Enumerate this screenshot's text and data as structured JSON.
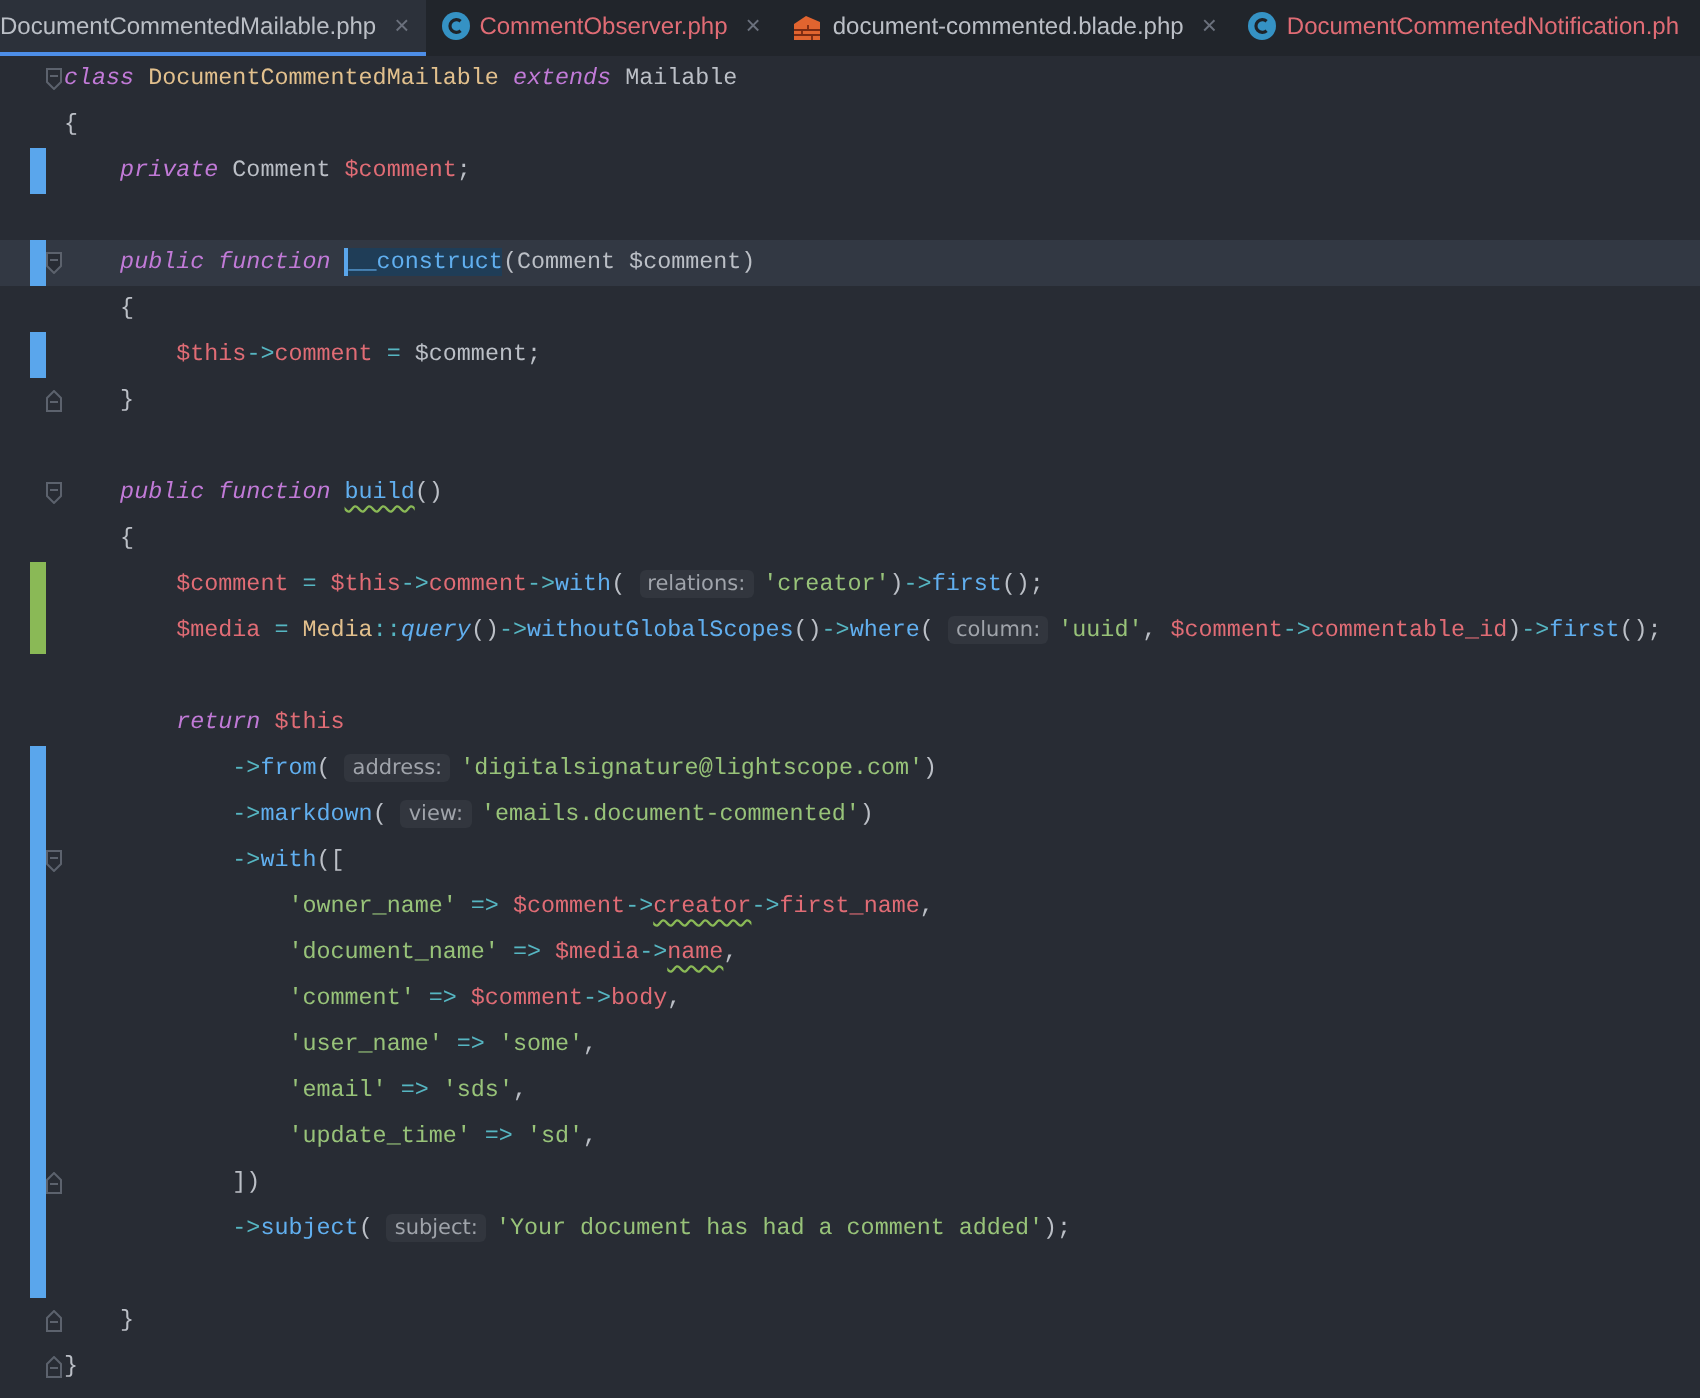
{
  "tabs": [
    {
      "label": "DocumentCommentedMailable.php",
      "kind": "plain",
      "has_errors": false,
      "selected": true,
      "close": "×"
    },
    {
      "label": "CommentObserver.php",
      "kind": "class",
      "has_errors": true,
      "selected": false,
      "close": "×"
    },
    {
      "label": "document-commented.blade.php",
      "kind": "blade",
      "has_errors": false,
      "selected": false,
      "close": "×"
    },
    {
      "label": "DocumentCommentedNotification.ph",
      "kind": "class",
      "has_errors": true,
      "selected": false
    }
  ],
  "lines": [
    {
      "kind": "unchanged",
      "fold_open": true,
      "fold_close": false,
      "current": false,
      "tokens": [
        {
          "kind": "kw",
          "text": "class "
        },
        {
          "kind": "type",
          "text": "DocumentCommentedMailable "
        },
        {
          "kind": "kw",
          "text": "extends"
        },
        {
          "kind": "plain",
          "text": " Mailable"
        }
      ]
    },
    {
      "kind": "unchanged",
      "fold_open": false,
      "fold_close": false,
      "current": false,
      "tokens": [
        {
          "kind": "plain",
          "text": "{"
        }
      ]
    },
    {
      "kind": "modified",
      "fold_open": false,
      "fold_close": false,
      "current": false,
      "tokens": [
        {
          "kind": "kw",
          "text": "    private"
        },
        {
          "kind": "plain",
          "text": " Comment "
        },
        {
          "kind": "var",
          "text": "$comment"
        },
        {
          "kind": "plain",
          "text": ";"
        }
      ]
    },
    {
      "kind": "unchanged",
      "fold_open": false,
      "fold_close": false,
      "current": false
    },
    {
      "kind": "modified",
      "fold_open": true,
      "fold_close": false,
      "current": true,
      "tokens": [
        {
          "kind": "kw",
          "text": "    public function "
        },
        {
          "kind": "fn-selected",
          "text": "__construct"
        },
        {
          "kind": "plain",
          "text": "(Comment $comment)"
        }
      ]
    },
    {
      "kind": "unchanged",
      "fold_open": false,
      "fold_close": false,
      "current": false,
      "tokens": [
        {
          "kind": "plain",
          "text": "    {"
        }
      ]
    },
    {
      "kind": "modified",
      "fold_open": false,
      "fold_close": false,
      "current": false,
      "tokens": [
        {
          "kind": "var",
          "text": "        $this"
        },
        {
          "kind": "op",
          "text": "->"
        },
        {
          "kind": "var",
          "text": "comment"
        },
        {
          "kind": "op",
          "text": " = "
        },
        {
          "kind": "plain",
          "text": "$comment;"
        }
      ]
    },
    {
      "kind": "unchanged",
      "fold_open": false,
      "fold_close": true,
      "current": false,
      "tokens": [
        {
          "kind": "plain",
          "text": "    }"
        }
      ]
    },
    {
      "kind": "unchanged",
      "fold_open": false,
      "fold_close": false,
      "current": false
    },
    {
      "kind": "unchanged",
      "fold_open": true,
      "fold_close": false,
      "current": false,
      "tokens": [
        {
          "kind": "kw",
          "text": "    public function "
        },
        {
          "kind": "fn-typo",
          "text": "build"
        },
        {
          "kind": "plain",
          "text": "()"
        }
      ]
    },
    {
      "kind": "unchanged",
      "fold_open": false,
      "fold_close": false,
      "current": false,
      "tokens": [
        {
          "kind": "plain",
          "text": "    {"
        }
      ]
    },
    {
      "kind": "added",
      "fold_open": false,
      "fold_close": false,
      "current": false,
      "tokens": [
        {
          "kind": "var",
          "text": "        $comment"
        },
        {
          "kind": "op",
          "text": " = "
        },
        {
          "kind": "var",
          "text": "$this"
        },
        {
          "kind": "op",
          "text": "->"
        },
        {
          "kind": "var",
          "text": "comment"
        },
        {
          "kind": "op",
          "text": "->"
        },
        {
          "kind": "fn",
          "text": "with"
        },
        {
          "kind": "plain",
          "text": "( "
        },
        {
          "kind": "hint",
          "text": "relations:"
        },
        {
          "kind": "str",
          "text": "'creator'"
        },
        {
          "kind": "plain",
          "text": ")"
        },
        {
          "kind": "op",
          "text": "->"
        },
        {
          "kind": "fn",
          "text": "first"
        },
        {
          "kind": "plain",
          "text": "();"
        }
      ]
    },
    {
      "kind": "added",
      "fold_open": false,
      "fold_close": false,
      "current": false,
      "tokens": [
        {
          "kind": "var",
          "text": "        $media"
        },
        {
          "kind": "op",
          "text": " = "
        },
        {
          "kind": "type",
          "text": "Media"
        },
        {
          "kind": "op",
          "text": "::"
        },
        {
          "kind": "fn-static",
          "text": "query"
        },
        {
          "kind": "plain",
          "text": "()"
        },
        {
          "kind": "op",
          "text": "->"
        },
        {
          "kind": "fn",
          "text": "withoutGlobalScopes"
        },
        {
          "kind": "plain",
          "text": "()"
        },
        {
          "kind": "op",
          "text": "->"
        },
        {
          "kind": "fn",
          "text": "where"
        },
        {
          "kind": "plain",
          "text": "( "
        },
        {
          "kind": "hint",
          "text": "column:"
        },
        {
          "kind": "str",
          "text": "'uuid'"
        },
        {
          "kind": "plain",
          "text": ", "
        },
        {
          "kind": "var",
          "text": "$comment"
        },
        {
          "kind": "op",
          "text": "->"
        },
        {
          "kind": "var",
          "text": "commentable_id"
        },
        {
          "kind": "plain",
          "text": ")"
        },
        {
          "kind": "op",
          "text": "->"
        },
        {
          "kind": "fn",
          "text": "first"
        },
        {
          "kind": "plain",
          "text": "();"
        }
      ]
    },
    {
      "kind": "unchanged",
      "fold_open": false,
      "fold_close": false,
      "current": false
    },
    {
      "kind": "unchanged",
      "fold_open": false,
      "fold_close": false,
      "current": false,
      "tokens": [
        {
          "kind": "kw",
          "text": "        return "
        },
        {
          "kind": "var",
          "text": "$this"
        }
      ]
    },
    {
      "kind": "modified",
      "fold_open": false,
      "fold_close": false,
      "current": false,
      "tokens": [
        {
          "kind": "op",
          "text": "            ->"
        },
        {
          "kind": "fn",
          "text": "from"
        },
        {
          "kind": "plain",
          "text": "( "
        },
        {
          "kind": "hint",
          "text": "address:"
        },
        {
          "kind": "str",
          "text": "'digitalsignature@lightscope.com'"
        },
        {
          "kind": "plain",
          "text": ")"
        }
      ]
    },
    {
      "kind": "modified",
      "fold_open": false,
      "fold_close": false,
      "current": false,
      "tokens": [
        {
          "kind": "op",
          "text": "            ->"
        },
        {
          "kind": "fn",
          "text": "markdown"
        },
        {
          "kind": "plain",
          "text": "( "
        },
        {
          "kind": "hint",
          "text": "view:"
        },
        {
          "kind": "str",
          "text": "'emails.document-commented'"
        },
        {
          "kind": "plain",
          "text": ")"
        }
      ]
    },
    {
      "kind": "modified",
      "fold_open": true,
      "fold_close": false,
      "current": false,
      "tokens": [
        {
          "kind": "op",
          "text": "            ->"
        },
        {
          "kind": "fn",
          "text": "with"
        },
        {
          "kind": "plain",
          "text": "(["
        }
      ]
    },
    {
      "kind": "modified",
      "fold_open": false,
      "fold_close": false,
      "current": false,
      "tokens": [
        {
          "kind": "str",
          "text": "                'owner_name'"
        },
        {
          "kind": "op",
          "text": " => "
        },
        {
          "kind": "var",
          "text": "$comment"
        },
        {
          "kind": "op",
          "text": "->"
        },
        {
          "kind": "var-typo",
          "text": "creator"
        },
        {
          "kind": "op",
          "text": "->"
        },
        {
          "kind": "var",
          "text": "first_name"
        },
        {
          "kind": "plain",
          "text": ","
        }
      ]
    },
    {
      "kind": "modified",
      "fold_open": false,
      "fold_close": false,
      "current": false,
      "tokens": [
        {
          "kind": "str",
          "text": "                'document_name'"
        },
        {
          "kind": "op",
          "text": " => "
        },
        {
          "kind": "var",
          "text": "$media"
        },
        {
          "kind": "op",
          "text": "->"
        },
        {
          "kind": "var-typo",
          "text": "name"
        },
        {
          "kind": "plain",
          "text": ","
        }
      ]
    },
    {
      "kind": "modified",
      "fold_open": false,
      "fold_close": false,
      "current": false,
      "tokens": [
        {
          "kind": "str",
          "text": "                'comment'"
        },
        {
          "kind": "op",
          "text": " => "
        },
        {
          "kind": "var",
          "text": "$comment"
        },
        {
          "kind": "op",
          "text": "->"
        },
        {
          "kind": "var",
          "text": "body"
        },
        {
          "kind": "plain",
          "text": ","
        }
      ]
    },
    {
      "kind": "modified",
      "fold_open": false,
      "fold_close": false,
      "current": false,
      "tokens": [
        {
          "kind": "str",
          "text": "                'user_name'"
        },
        {
          "kind": "op",
          "text": " => "
        },
        {
          "kind": "str",
          "text": "'some'"
        },
        {
          "kind": "plain",
          "text": ","
        }
      ]
    },
    {
      "kind": "modified",
      "fold_open": false,
      "fold_close": false,
      "current": false,
      "tokens": [
        {
          "kind": "str",
          "text": "                'email'"
        },
        {
          "kind": "op",
          "text": " => "
        },
        {
          "kind": "str",
          "text": "'sds'"
        },
        {
          "kind": "plain",
          "text": ","
        }
      ]
    },
    {
      "kind": "modified",
      "fold_open": false,
      "fold_close": false,
      "current": false,
      "tokens": [
        {
          "kind": "str",
          "text": "                'update_time'"
        },
        {
          "kind": "op",
          "text": " => "
        },
        {
          "kind": "str",
          "text": "'sd'"
        },
        {
          "kind": "plain",
          "text": ","
        }
      ]
    },
    {
      "kind": "modified",
      "fold_open": false,
      "fold_close": true,
      "current": false,
      "tokens": [
        {
          "kind": "plain",
          "text": "            ])"
        }
      ]
    },
    {
      "kind": "modified",
      "fold_open": false,
      "fold_close": false,
      "current": false,
      "tokens": [
        {
          "kind": "op",
          "text": "            ->"
        },
        {
          "kind": "fn",
          "text": "subject"
        },
        {
          "kind": "plain",
          "text": "( "
        },
        {
          "kind": "hint",
          "text": "subject:"
        },
        {
          "kind": "str",
          "text": "'Your document has had a comment added'"
        },
        {
          "kind": "plain",
          "text": ");"
        }
      ]
    },
    {
      "kind": "modified",
      "fold_open": false,
      "fold_close": false,
      "current": false
    },
    {
      "kind": "unchanged",
      "fold_open": false,
      "fold_close": true,
      "current": false,
      "tokens": [
        {
          "kind": "plain",
          "text": "    }"
        }
      ]
    },
    {
      "kind": "unchanged",
      "fold_open": false,
      "fold_close": true,
      "current": false,
      "tokens": [
        {
          "kind": "plain",
          "text": "}"
        }
      ]
    }
  ]
}
